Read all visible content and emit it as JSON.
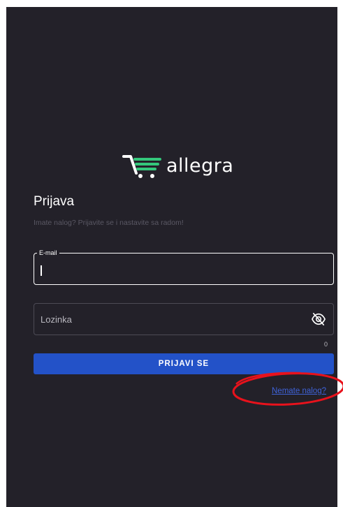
{
  "brand": {
    "logo_text": "allegra",
    "logo_icon": "shopping-cart-icon",
    "accent_color": "#34c77b"
  },
  "login": {
    "title": "Prijava",
    "subtitle": "Imate nalog? Prijavite se i nastavite sa radom!",
    "email_label": "E-mail",
    "email_value": "",
    "password_label": "Lozinka",
    "password_value": "",
    "password_counter": "0",
    "password_visibility_icon": "eye-slash-icon",
    "submit_label": "PRIJAVI SE",
    "register_link": "Nemate nalog?"
  },
  "colors": {
    "background": "#232129",
    "primary_button": "#2352c8",
    "link": "#3f63d9",
    "annotation": "#e8121c"
  }
}
